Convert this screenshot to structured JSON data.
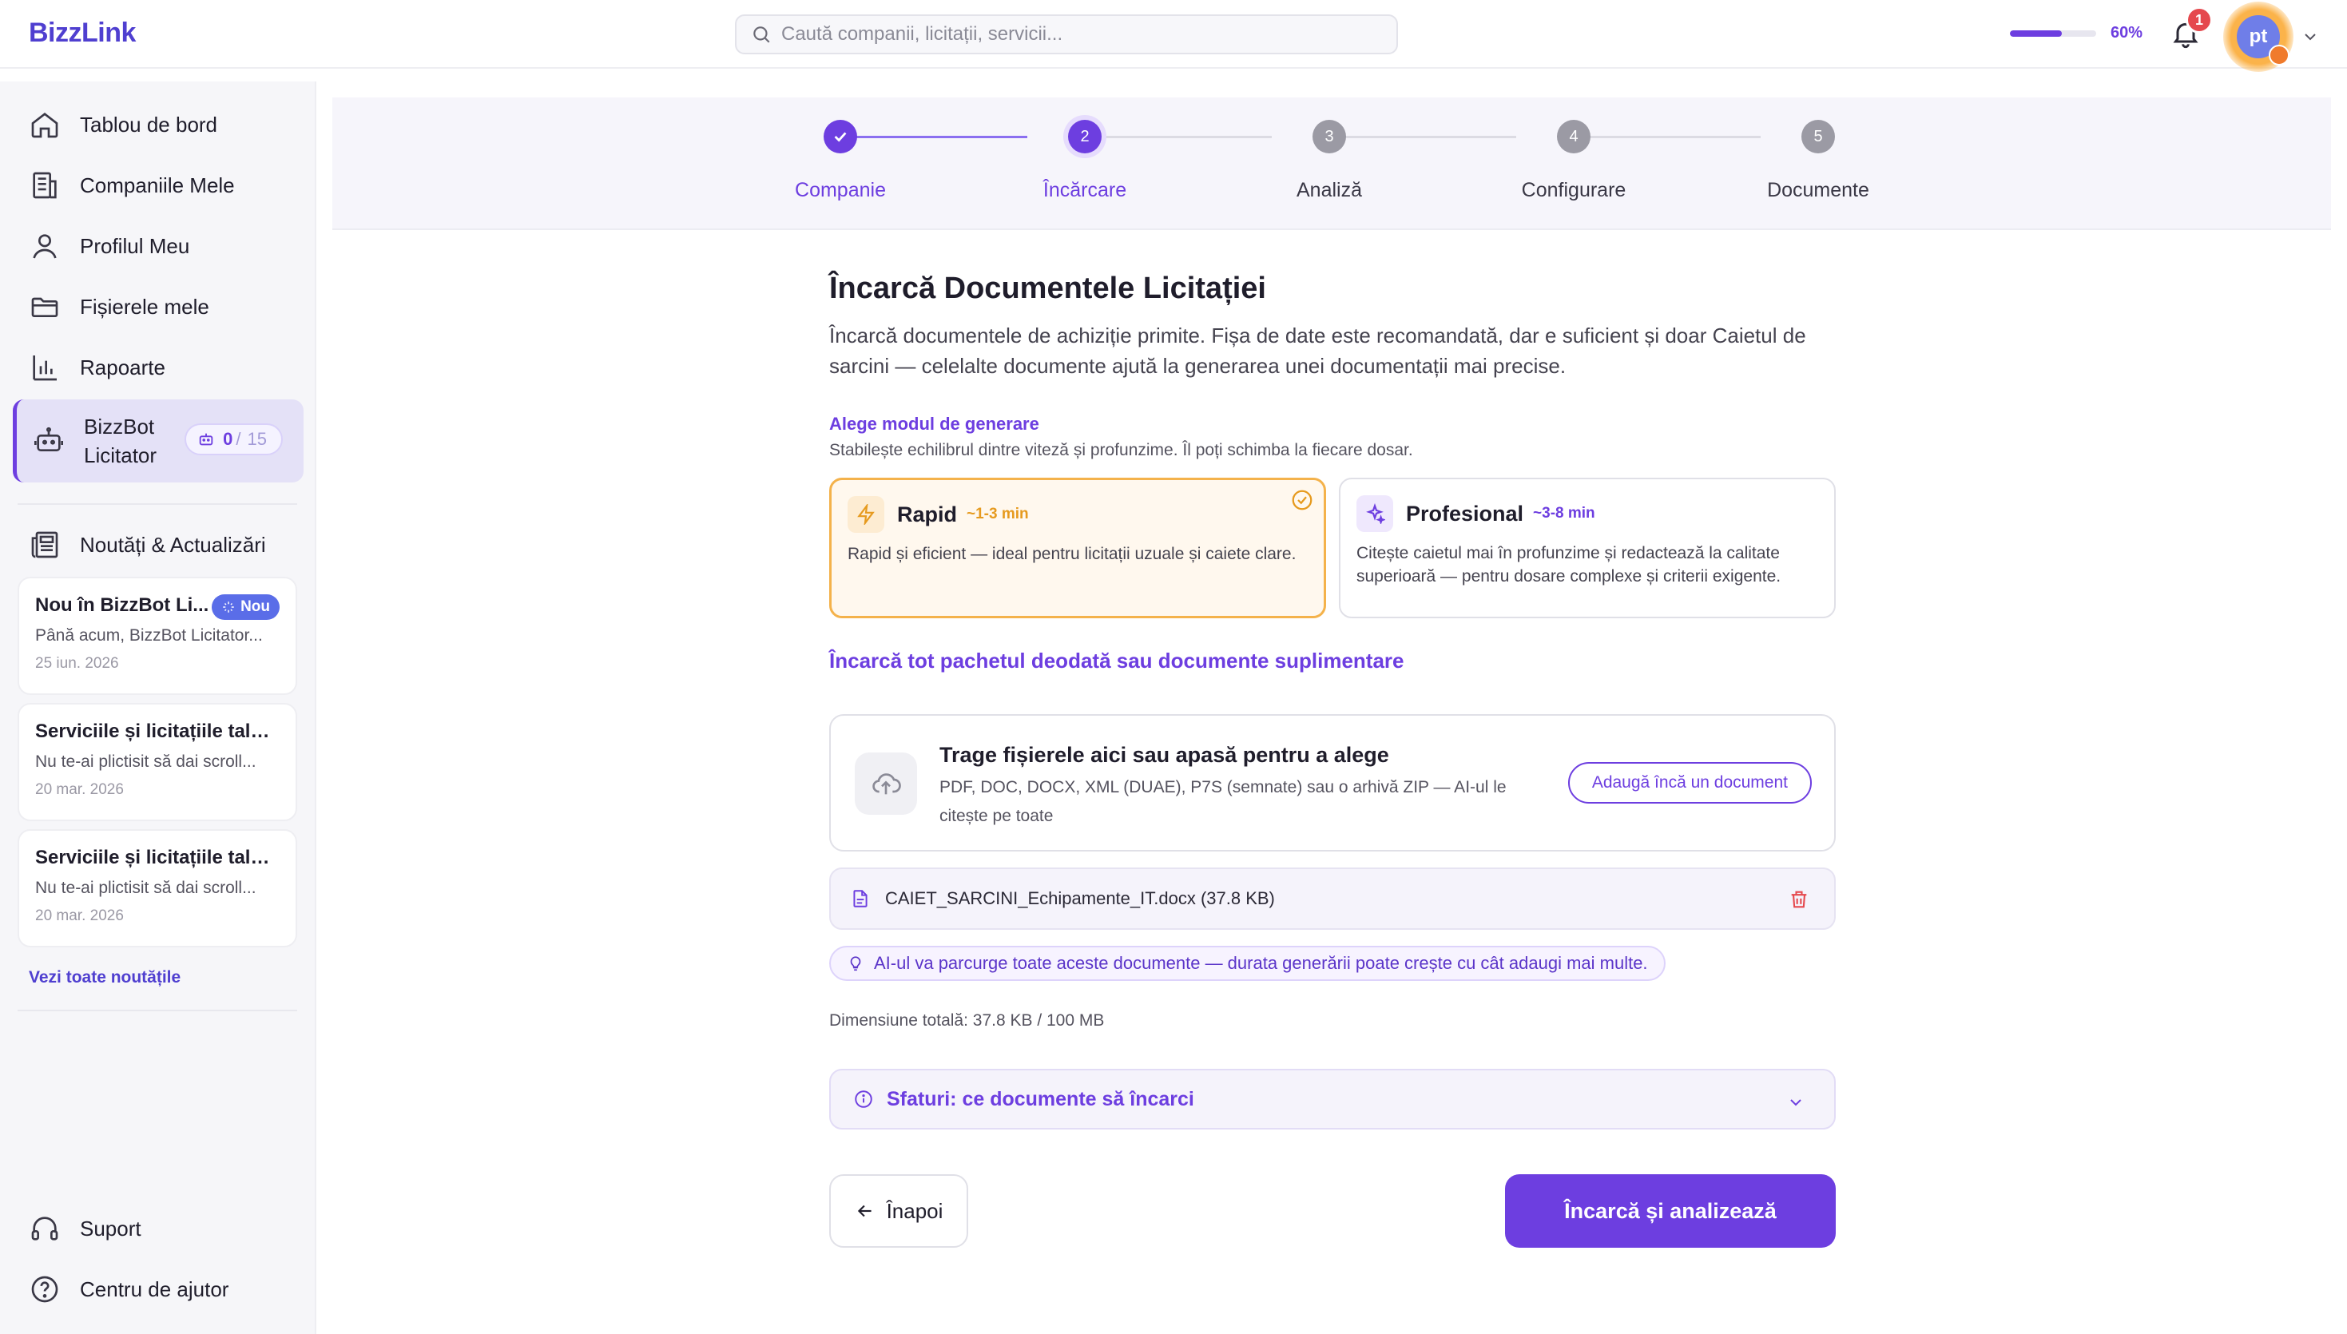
{
  "app": {
    "logo": "BizzLink"
  },
  "search": {
    "placeholder": "Caută companii, licitații, servicii..."
  },
  "header": {
    "profile_progress": 0.6,
    "profile_progress_label": "60%",
    "notifications_count": "1",
    "user_initials": "pt"
  },
  "sidebar": {
    "items": [
      {
        "label": "Tablou de bord",
        "icon": "home-icon"
      },
      {
        "label": "Companiile Mele",
        "icon": "building-icon"
      },
      {
        "label": "Profilul Meu",
        "icon": "user-icon"
      },
      {
        "label": "Fișierele mele",
        "icon": "folder-icon"
      },
      {
        "label": "Rapoarte",
        "icon": "bar-chart-icon"
      },
      {
        "label": "BizzBot Licitator",
        "icon": "robot-icon",
        "active": true,
        "quota_used": "0",
        "quota_separator": "/",
        "quota_total": "15"
      },
      {
        "label": "Noutăți & Actualizări",
        "icon": "newspaper-icon"
      }
    ],
    "news": [
      {
        "title": "Nou în BizzBot Li...",
        "badge": "Nou",
        "text": "Până acum, BizzBot Licitator...",
        "date": "25 iun. 2026"
      },
      {
        "title": "Serviciile și licitațiile tale,...",
        "text": "Nu te-ai plictisit să dai scroll...",
        "date": "20 mar. 2026"
      },
      {
        "title": "Serviciile și licitațiile tale,...",
        "text": "Nu te-ai plictisit să dai scroll...",
        "date": "20 mar. 2026"
      }
    ],
    "news_link": "Vezi toate noutățile",
    "bottom": [
      {
        "label": "Suport",
        "icon": "headset-icon"
      },
      {
        "label": "Centru de ajutor",
        "icon": "help-circle-icon"
      }
    ]
  },
  "stepper": {
    "steps": [
      {
        "label": "Companie",
        "number": "1",
        "state": "done"
      },
      {
        "label": "Încărcare",
        "number": "2",
        "state": "current"
      },
      {
        "label": "Analiză",
        "number": "3",
        "state": "pending"
      },
      {
        "label": "Configurare",
        "number": "4",
        "state": "pending"
      },
      {
        "label": "Documente",
        "number": "5",
        "state": "pending"
      }
    ]
  },
  "main": {
    "title": "Încarcă Documentele Licitației",
    "description": "Încarcă documentele de achiziție primite. Fișa de date este recomandată, dar e suficient și doar Caietul de sarcini — celelalte documente ajută la generarea unei documentații mai precise.",
    "mode_title": "Alege modul de generare",
    "mode_subtitle": "Stabilește echilibrul dintre viteză și profunzime. Îl poți schimba la fiecare dosar.",
    "modes": [
      {
        "name": "Rapid",
        "time": "~1-3 min",
        "desc": "Rapid și eficient — ideal pentru licitații uzuale și caiete clare.",
        "selected": true,
        "icon": "lightning-icon"
      },
      {
        "name": "Profesional",
        "time": "~3-8 min",
        "desc": "Citește caietul mai în profunzime și redactează la calitate superioară — pentru dosare complexe și criterii exigente.",
        "selected": false,
        "icon": "sparkles-icon"
      }
    ],
    "upload_heading": "Încarcă tot pachetul deodată sau documente suplimentare",
    "dropzone": {
      "title": "Trage fișierele aici sau apasă pentru a alege",
      "text": "PDF, DOC, DOCX, XML (DUAE), P7S (semnate) sau o arhivă ZIP — AI-ul le citește pe toate",
      "button": "Adaugă încă un document"
    },
    "files": [
      {
        "name": "CAIET_SARCINI_Echipamente_IT.docx (37.8 KB)"
      }
    ],
    "ai_note": "AI-ul va parcurge toate aceste documente — durata generării poate crește cu cât adaugi mai multe.",
    "total_size": "Dimensiune totală: 37.8 KB / 100 MB",
    "tips_label": "Sfaturi: ce documente să încarci",
    "back_label": "Înapoi",
    "submit_label": "Încarcă și analizează"
  },
  "colors": {
    "accent": "#6d3ee0",
    "rapid_accent": "#f4b24b",
    "danger": "#e5484d"
  }
}
